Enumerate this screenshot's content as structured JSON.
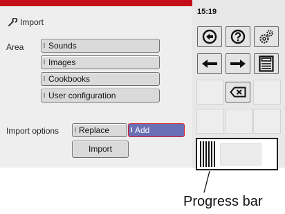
{
  "header": {
    "time": "15:19",
    "title": "Import"
  },
  "area": {
    "label": "Area",
    "items": [
      {
        "label": "Sounds"
      },
      {
        "label": "Images"
      },
      {
        "label": "Cookbooks"
      },
      {
        "label": "User configuration"
      }
    ]
  },
  "import_options": {
    "label": "Import options",
    "options": [
      {
        "label": "Replace",
        "selected": false
      },
      {
        "label": "Add",
        "selected": true
      }
    ]
  },
  "actions": {
    "import_label": "Import"
  },
  "icons": [
    "back-circle-icon",
    "help-icon",
    "settings-gears-icon",
    "arrow-left-icon",
    "arrow-right-icon",
    "save-icon",
    "backspace-icon"
  ],
  "progress": {
    "fraction": 0.22
  },
  "annotation": {
    "label": "Progress bar"
  },
  "colors": {
    "accent_bar": "#c40f1a",
    "selected_option": "#6b6fb6",
    "selected_border": "#d2202a"
  }
}
